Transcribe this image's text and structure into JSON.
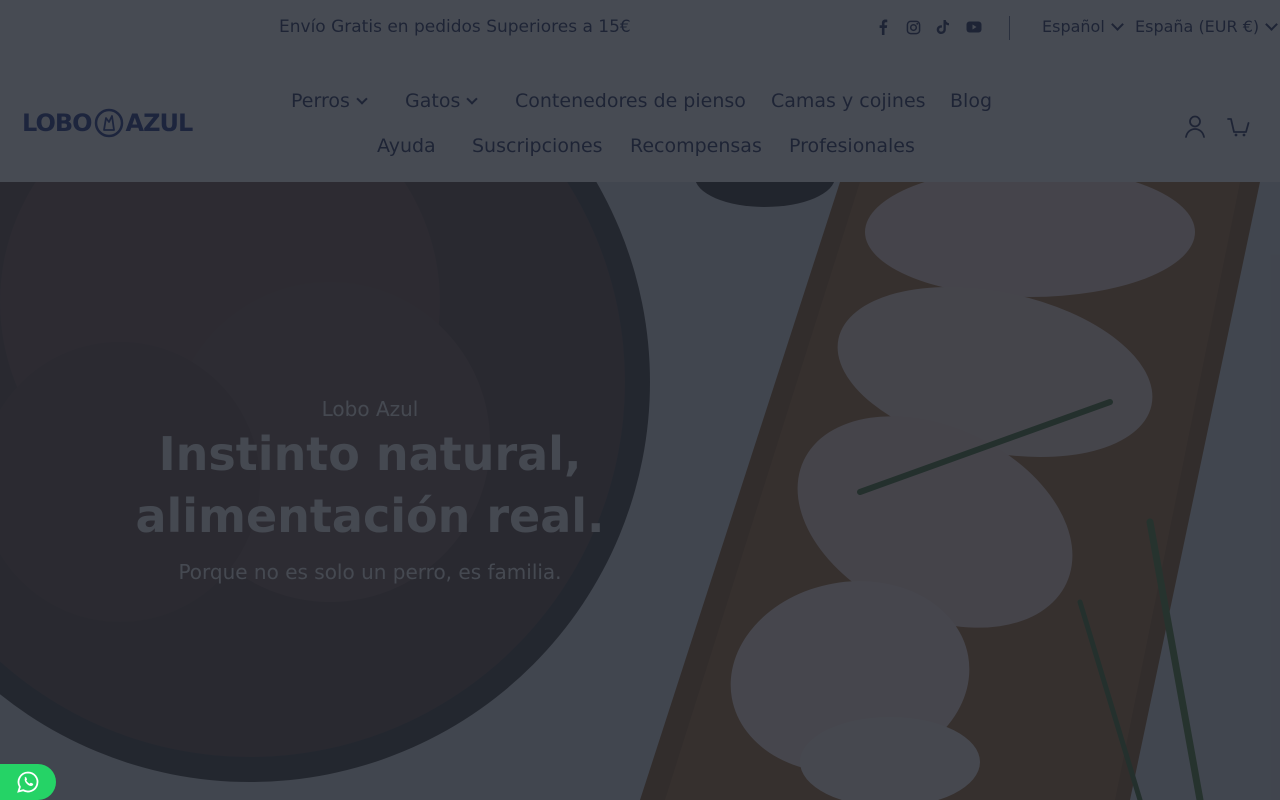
{
  "announcement": "Envío Gratis en pedidos Superiores a 15€",
  "social": [
    "facebook-icon",
    "instagram-icon",
    "tiktok-icon",
    "youtube-icon"
  ],
  "selectors": {
    "language": "Español",
    "country": "España (EUR €)"
  },
  "logo": {
    "left": "LOBO",
    "right": "AZUL"
  },
  "nav": {
    "row1": [
      {
        "label": "Perros",
        "dropdown": true
      },
      {
        "label": "Gatos",
        "dropdown": true
      },
      {
        "label": "Contenedores de pienso",
        "dropdown": false
      },
      {
        "label": "Camas y cojines",
        "dropdown": false
      },
      {
        "label": "Blog",
        "dropdown": false
      }
    ],
    "row2": [
      {
        "label": "Ayuda"
      },
      {
        "label": "Suscripciones"
      },
      {
        "label": "Recompensas"
      },
      {
        "label": "Profesionales"
      }
    ]
  },
  "header_icons": [
    "account-icon",
    "cart-icon"
  ],
  "hero": {
    "kicker": "Lobo Azul",
    "headline_1": "Instinto natural,",
    "headline_2": "alimentación real.",
    "subline": "Porque no es solo un perro, es familia."
  },
  "colors": {
    "brand": "#1a2f88",
    "text": "#1f2a5c",
    "overlay": "rgba(30,35,45,0.82)",
    "whatsapp": "#25d366"
  }
}
